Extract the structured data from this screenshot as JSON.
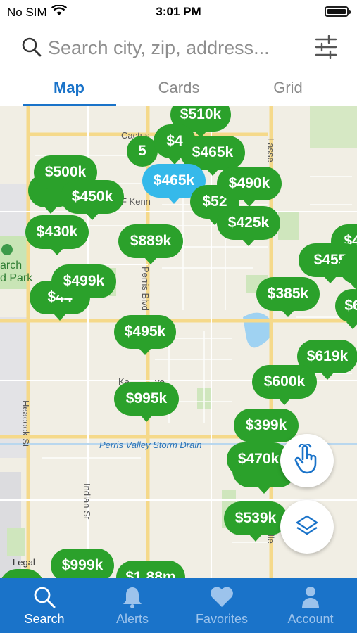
{
  "status": {
    "carrier": "No SIM",
    "time": "3:01 PM",
    "wifi_icon": "wifi-icon",
    "battery_icon": "battery-icon"
  },
  "search": {
    "placeholder": "Search city, zip, address...",
    "value": ""
  },
  "tabs": [
    {
      "label": "Map",
      "active": true
    },
    {
      "label": "Cards",
      "active": false
    },
    {
      "label": "Grid",
      "active": false
    }
  ],
  "map": {
    "labels": {
      "cactus": "Cactus",
      "f_kenn": "F Kenn",
      "perris_blvd": "Perris Blvd",
      "lasse": "Lasse",
      "arch_park": "arch\nd Park",
      "heacock": "Heacock St",
      "indian": "Indian St",
      "storm_drain": "Perris Valley Storm Drain",
      "ka_ave": "Ka          ve",
      "legal": "Legal",
      "ille": "ille"
    },
    "pins": [
      {
        "price": "$510k"
      },
      {
        "price": "5"
      },
      {
        "price": "$4"
      },
      {
        "price": "$465k"
      },
      {
        "price": "$465k",
        "selected": true
      },
      {
        "price": "$500k"
      },
      {
        "price": "$450k"
      },
      {
        "price": "$52"
      },
      {
        "price": "$490k"
      },
      {
        "price": "$425k"
      },
      {
        "price": "$430k"
      },
      {
        "price": "$889k"
      },
      {
        "price": "$4"
      },
      {
        "price": "$455"
      },
      {
        "price": "$499k"
      },
      {
        "price": "$44"
      },
      {
        "price": "$385k"
      },
      {
        "price": "$6"
      },
      {
        "price": "$495k"
      },
      {
        "price": "$619k"
      },
      {
        "price": "$600k"
      },
      {
        "price": "$995k"
      },
      {
        "price": "$399k"
      },
      {
        "price": "$470k"
      },
      {
        "price": "$539k"
      },
      {
        "price": "$999k"
      },
      {
        "price": "$1.88m"
      }
    ],
    "draw_button_icon": "hand-pointer-icon",
    "layers_button_icon": "layers-icon"
  },
  "nav": [
    {
      "label": "Search",
      "icon": "search-icon",
      "active": true
    },
    {
      "label": "Alerts",
      "icon": "bell-icon",
      "active": false
    },
    {
      "label": "Favorites",
      "icon": "heart-icon",
      "active": false
    },
    {
      "label": "Account",
      "icon": "person-icon",
      "active": false
    }
  ],
  "colors": {
    "accent": "#1a73c9",
    "pin": "#2ba12b",
    "selected_pin": "#35b9ea"
  }
}
